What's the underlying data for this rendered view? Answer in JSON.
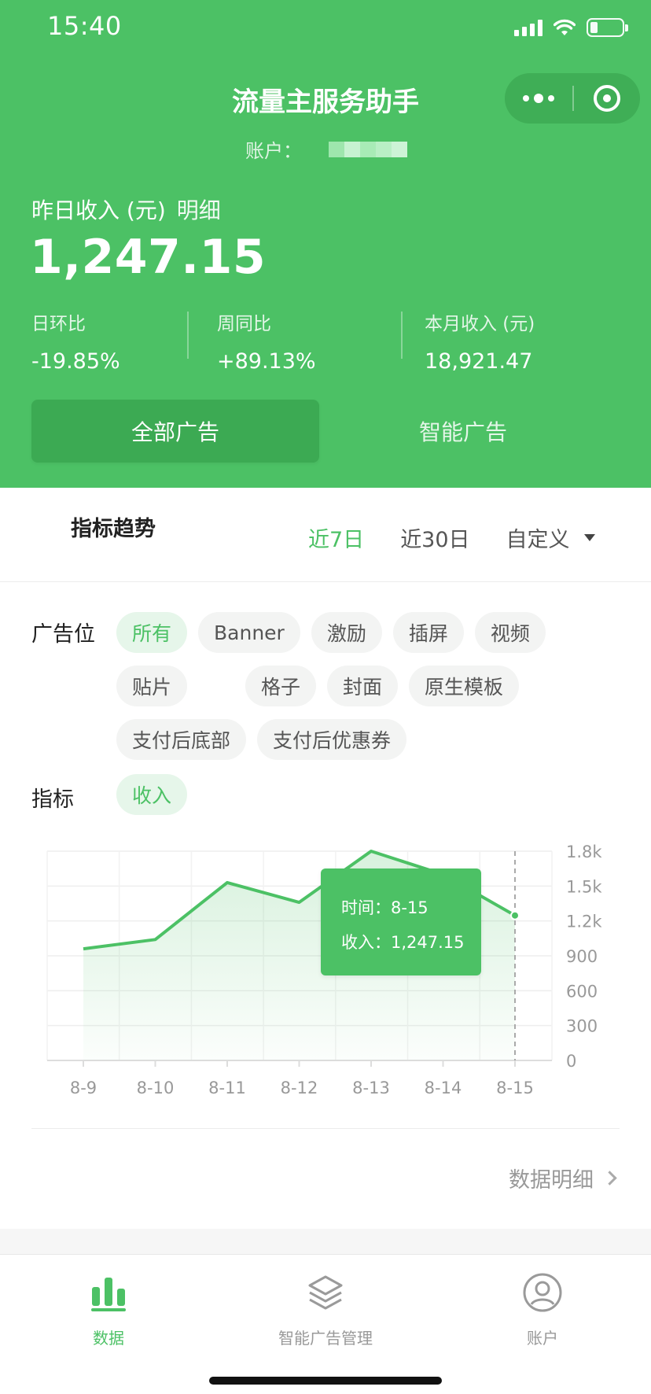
{
  "status_bar": {
    "time": "15:40"
  },
  "header": {
    "app_title": "流量主服务助手",
    "account_label": "账户：",
    "income_label": "昨日收入 (元)",
    "income_detail": "明细",
    "income_value": "1,247.15",
    "stats": [
      {
        "label": "日环比",
        "value": "-19.85%"
      },
      {
        "label": "周同比",
        "value": "+89.13%"
      },
      {
        "label": "本月收入 (元)",
        "value": "18,921.47"
      }
    ],
    "segments": {
      "all": "全部广告",
      "smart": "智能广告"
    }
  },
  "trend": {
    "title": "指标趋势",
    "ranges": {
      "r7": "近7日",
      "r30": "近30日",
      "custom": "自定义"
    },
    "ad_position_label": "广告位",
    "ad_positions": [
      "所有",
      "Banner",
      "激励",
      "插屏",
      "视频",
      "贴片",
      "格子",
      "封面",
      "原生模板",
      "支付后底部",
      "支付后优惠券"
    ],
    "metric_label": "指标",
    "metrics": [
      "收入"
    ],
    "tooltip": {
      "time_line": "时间：8-15",
      "income_line": "收入：1,247.15"
    },
    "detail_link": "数据明细"
  },
  "chart_data": {
    "type": "area",
    "x": [
      "8-9",
      "8-10",
      "8-11",
      "8-12",
      "8-13",
      "8-14",
      "8-15"
    ],
    "series": [
      {
        "values": [
          960,
          1040,
          1530,
          1360,
          1800,
          1600,
          1247.15
        ]
      }
    ],
    "y_ticks": [
      "0",
      "300",
      "600",
      "900",
      "1.2k",
      "1.5k",
      "1.8k"
    ],
    "ylim": [
      0,
      1800
    ],
    "grid": true,
    "highlight_index": 6
  },
  "tabbar": {
    "data": "数据",
    "smart_manage": "智能广告管理",
    "account": "账户"
  },
  "colors": {
    "brand_green": "#4cc165",
    "dark_green": "#3caa53",
    "chip_bg": "#f3f4f3",
    "chip_active_bg": "#e6f6ea"
  }
}
